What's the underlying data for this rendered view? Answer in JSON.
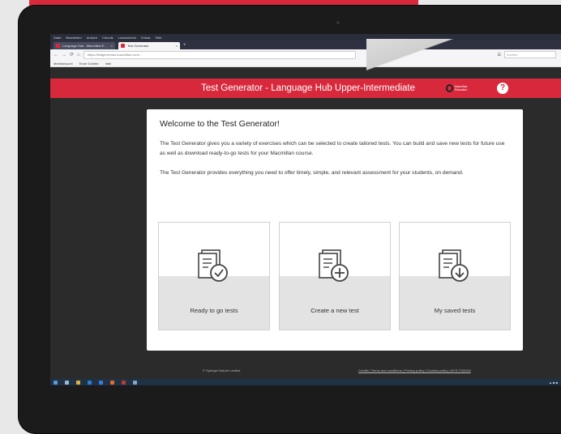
{
  "menubar": {
    "items": [
      "Datei",
      "Bearbeiten",
      "Ansicht",
      "Chronik",
      "Lesezeichen",
      "Extras",
      "Hilfe"
    ]
  },
  "tabs": [
    {
      "label": "Language Hub - Macmillan E..."
    },
    {
      "label": "Test Generator"
    }
  ],
  "toolbar": {
    "url": "https://testgenerator.macmillan.com/...",
    "search_placeholder": "Suchen",
    "back": "←",
    "forward": "→",
    "reload": "⟳",
    "home": "⌂"
  },
  "bookmarks": [
    "Meistbesucht",
    "Erste Schritte",
    "Intel"
  ],
  "app": {
    "title": "Test Generator - Language Hub Upper-Intermediate",
    "brand": "Macmillan Education",
    "help_glyph": "?",
    "accent": "#d8293c"
  },
  "welcome": {
    "title": "Welcome to the Test Generator!",
    "p1": "The Test Generator gives you a variety of exercises which can be selected to create tailored tests. You can build and save new tests for future use as well as download ready-to-go tests for your Macmillan course.",
    "p2": "The Test Generator provides everything you need to offer timely, simple, and relevant assessment for your students, on demand."
  },
  "cards": [
    {
      "label": "Ready to go tests",
      "icon": "document-check-icon"
    },
    {
      "label": "Create a new test",
      "icon": "document-plus-icon"
    },
    {
      "label": "My saved tests",
      "icon": "document-download-icon"
    }
  ],
  "footer": {
    "left": "© Springer Nature Limited",
    "right": "Credits | Terms and conditions | Privacy policy | Cookies policy | MYS-TGBOW"
  }
}
